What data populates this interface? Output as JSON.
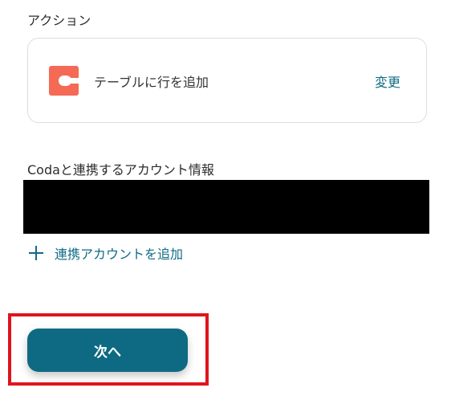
{
  "action_section": {
    "label": "アクション",
    "card": {
      "app_icon": "coda-logo-icon",
      "app_icon_color": "#f46a54",
      "action_name": "テーブルに行を追加",
      "change_label": "変更"
    }
  },
  "account_section": {
    "label": "Codaと連携するアカウント情報",
    "field_value": "",
    "add_account_label": "連携アカウントを追加",
    "add_icon": "plus-icon"
  },
  "footer": {
    "next_label": "次へ"
  },
  "colors": {
    "accent": "#0f6b85",
    "button": "#0e6a83",
    "highlight": "#e0141e"
  }
}
